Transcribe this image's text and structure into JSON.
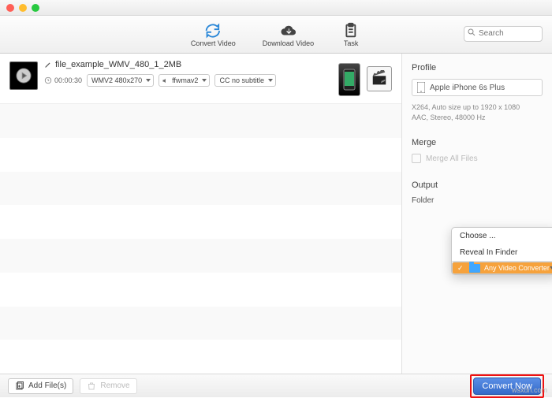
{
  "toolbar": {
    "items": [
      {
        "label": "Convert Video"
      },
      {
        "label": "Download Video"
      },
      {
        "label": "Task"
      }
    ],
    "search_placeholder": "Search"
  },
  "file": {
    "name": "file_example_WMV_480_1_2MB",
    "duration": "00:00:30",
    "format": "WMV2 480x270",
    "audio": "ffwmav2",
    "subtitle": "CC  no subtitle"
  },
  "sidebar": {
    "profile_heading": "Profile",
    "profile_value": "Apple iPhone 6s Plus",
    "profile_info_line1": "X264, Auto size up to 1920 x 1080",
    "profile_info_line2": "AAC, Stereo, 48000 Hz",
    "merge_heading": "Merge",
    "merge_check_label": "Merge All Files",
    "output_heading": "Output",
    "folder_label": "Folder"
  },
  "context_menu": {
    "choose": "Choose ...",
    "reveal": "Reveal In Finder",
    "selected": "Any Video Converter"
  },
  "footer": {
    "add": "Add File(s)",
    "remove": "Remove",
    "convert": "Convert Now"
  },
  "watermark": "wsxdn.com"
}
